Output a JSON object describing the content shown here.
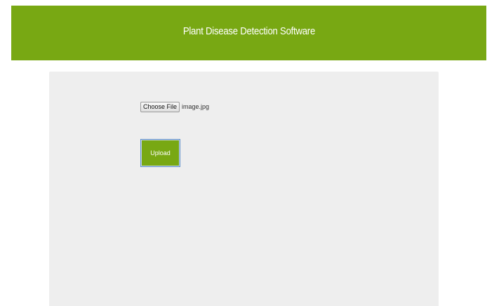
{
  "header": {
    "title": "Plant Disease Detection Software"
  },
  "upload_form": {
    "choose_file_label": "Choose File",
    "selected_file_name": "image.jpg",
    "upload_label": "Upload"
  },
  "colors": {
    "header_background": "#78a813",
    "panel_background": "#eeeeee",
    "upload_button_background": "#78a813"
  }
}
